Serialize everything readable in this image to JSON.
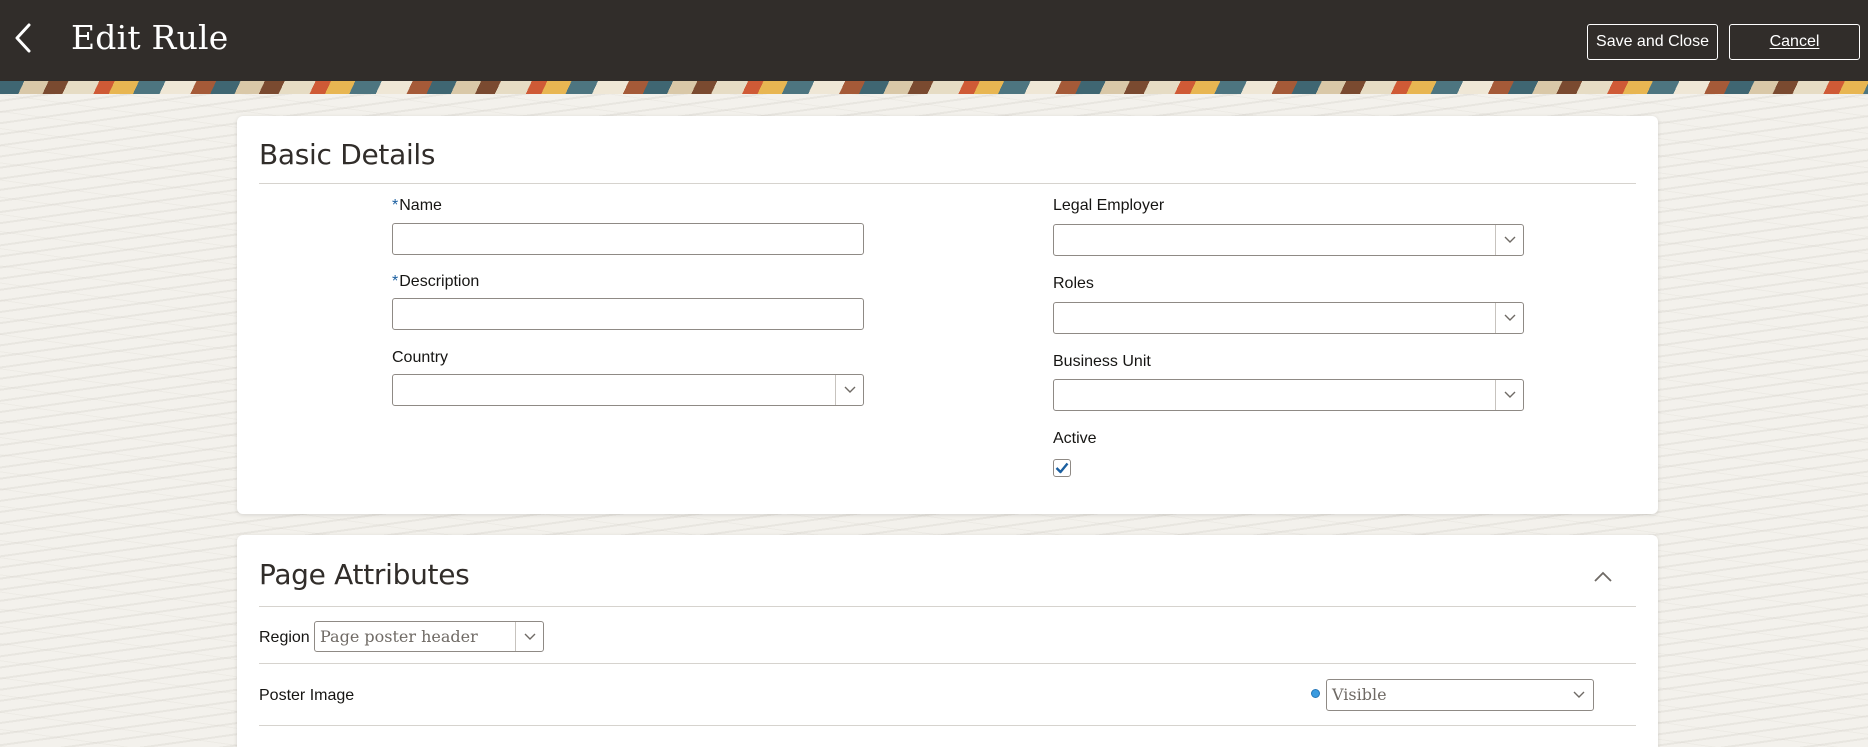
{
  "header": {
    "title": "Edit Rule",
    "save_close_label": "Save and Close",
    "cancel_label": "Cancel",
    "background": "#312d2a"
  },
  "basic_details": {
    "title": "Basic Details",
    "name": {
      "label": "Name",
      "required_mark": "*",
      "value": ""
    },
    "description": {
      "label": "Description",
      "required_mark": "*",
      "value": ""
    },
    "country": {
      "label": "Country",
      "value": ""
    },
    "legal_employer": {
      "label": "Legal Employer",
      "value": ""
    },
    "roles": {
      "label": "Roles",
      "value": ""
    },
    "business_unit": {
      "label": "Business Unit",
      "value": ""
    },
    "active": {
      "label": "Active",
      "checked": true
    }
  },
  "page_attributes": {
    "title": "Page Attributes",
    "region": {
      "label": "Region",
      "value": "Page poster header"
    },
    "poster_image": {
      "label": "Poster Image",
      "visibility": "Visible"
    }
  },
  "colors": {
    "accent": "#1b5fa0",
    "indicator": "#3a9be0"
  },
  "icons": {
    "back": "chevron-left-icon",
    "collapse": "chevron-up-icon",
    "dropdown": "chevron-down-icon",
    "check": "checkmark-icon"
  }
}
